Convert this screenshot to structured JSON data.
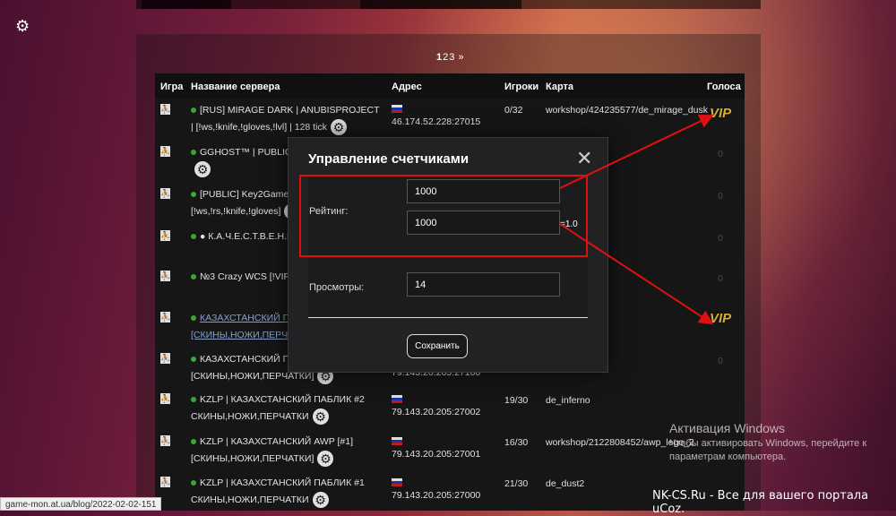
{
  "pagination": {
    "pages": [
      "1",
      "2",
      "3",
      "»"
    ],
    "current": "1"
  },
  "table": {
    "headers": {
      "game": "Игра",
      "name": "Название сервера",
      "address": "Адрес",
      "players": "Игроки",
      "map": "Карта",
      "votes": "Голоса"
    },
    "rows": [
      {
        "name": "[RUS] MIRAGE DARK | ANUBISPROJECT | [!ws,!knife,!gloves,!lvl] | 128 tick",
        "address": "46.174.52.228:27015",
        "players": "0/32",
        "map": "workshop/424235577/de_mirage_dusk",
        "vote": "VIP"
      },
      {
        "name": "GGHOST™ | PUBLIC",
        "address": "",
        "players": "",
        "map": "",
        "vote": "0"
      },
      {
        "name": "[PUBLIC] Key2Game | [!ws,!rs,!knife,!gloves]",
        "address": "",
        "players": "",
        "map": "",
        "vote": "0"
      },
      {
        "name": "● К.А.Ч.Е.С.Т.В.Е.Н.Н",
        "address": "",
        "players": "",
        "map": "",
        "vote": "0"
      },
      {
        "name": "№3 Crazy WCS [!VIP, !GLOVES]",
        "address": "",
        "players": "",
        "map": "",
        "vote": "0"
      },
      {
        "name": "КАЗАХСТАНСКИЙ ПА [СКИНЫ,НОЖИ,ПЕРЧА",
        "address": "",
        "players": "",
        "map": "",
        "vote": "VIP"
      },
      {
        "name": "КАЗАХСТАНСКИЙ ПА [СКИНЫ,НОЖИ,ПЕРЧАТКИ]",
        "address": "79.143.20.205:27100",
        "players": "",
        "map": "",
        "vote": "0"
      },
      {
        "name": "KZLP | КАЗАХСТАНСКИЙ ПАБЛИК #2 СКИНЫ,НОЖИ,ПЕРЧАТКИ",
        "address": "79.143.20.205:27002",
        "players": "19/30",
        "map": "de_inferno",
        "vote": ""
      },
      {
        "name": "KZLP | КАЗАХСТАНСКИЙ AWP [#1] [СКИНЫ,НОЖИ,ПЕРЧАТКИ]",
        "address": "79.143.20.205:27001",
        "players": "16/30",
        "map": "workshop/2122808452/awp_lego_2",
        "vote": ""
      },
      {
        "name": "KZLP | КАЗАХСТАНСКИЙ ПАБЛИК #1 СКИНЫ,НОЖИ,ПЕРЧАТКИ",
        "address": "79.143.20.205:27000",
        "players": "21/30",
        "map": "de_dust2",
        "vote": ""
      }
    ]
  },
  "modal": {
    "title": "Управление счетчиками",
    "rating_label": "Рейтинг:",
    "rating_value_1": "1000",
    "rating_value_2": "1000",
    "rating_suffix": "=1.0",
    "views_label": "Просмотры:",
    "views_value": "14",
    "save_label": "Сохранить",
    "close_glyph": "✕"
  },
  "windows": {
    "title": "Активация Windows",
    "subtitle": "Чтобы активировать Windows, перейдите к параметрам компьютера."
  },
  "footer": {
    "ucoz": "NK-CS.Ru - Все для вашего портала uCoz."
  },
  "status": {
    "url": "game-mon.at.ua/blog/2022-02-02-151"
  },
  "colors": {
    "annotation": "#e01010",
    "vip": "#f2c83a",
    "online": "#3fbf3f"
  }
}
